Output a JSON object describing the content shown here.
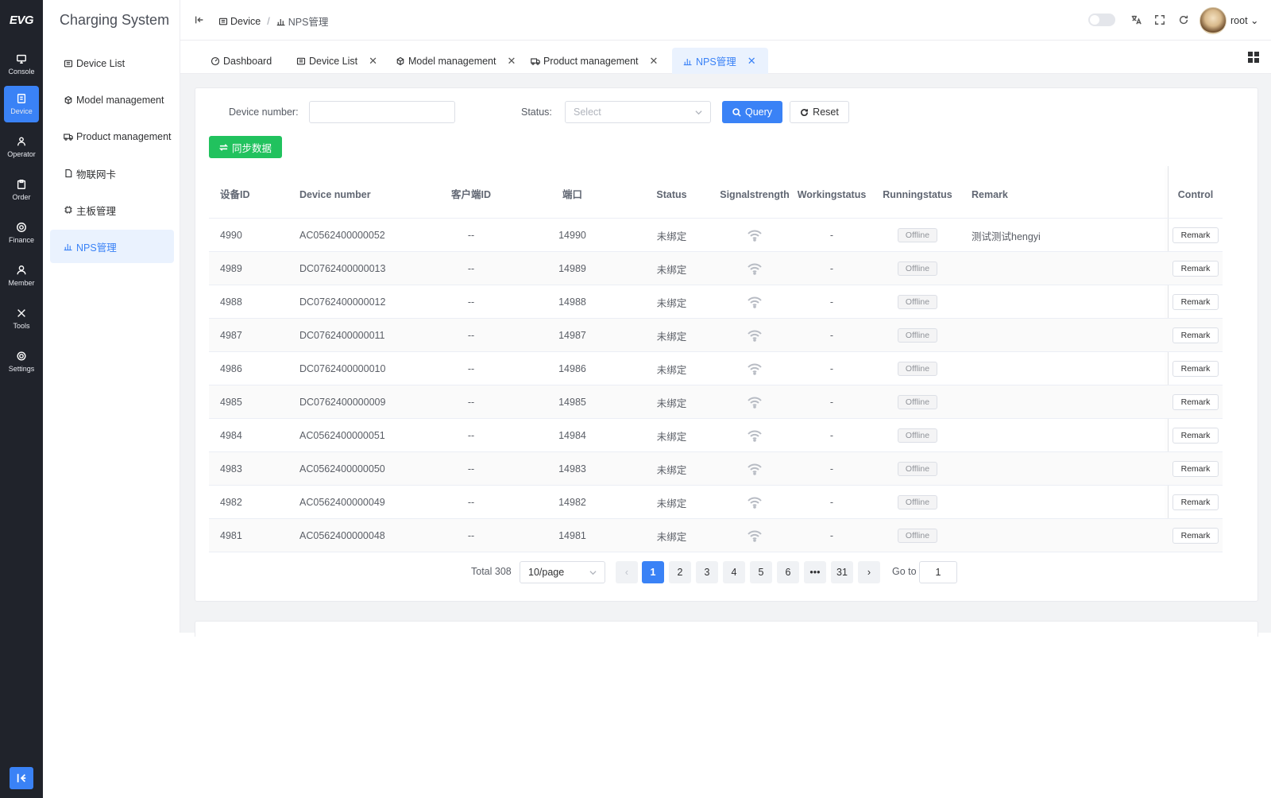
{
  "rail": {
    "logo": "EVG",
    "items": [
      {
        "label": "Console",
        "icon": "monitor-icon"
      },
      {
        "label": "Device",
        "icon": "device-icon"
      },
      {
        "label": "Operator",
        "icon": "operator-icon"
      },
      {
        "label": "Order",
        "icon": "clipboard-icon"
      },
      {
        "label": "Finance",
        "icon": "coin-icon"
      },
      {
        "label": "Member",
        "icon": "user-icon"
      },
      {
        "label": "Tools",
        "icon": "tools-icon"
      },
      {
        "label": "Settings",
        "icon": "gear-icon"
      }
    ]
  },
  "submenu": {
    "title": "Charging System",
    "items": [
      {
        "label": "Device List",
        "icon": "device-list-icon"
      },
      {
        "label": "Model management",
        "icon": "cube-icon"
      },
      {
        "label": "Product management",
        "icon": "truck-icon"
      },
      {
        "label": "物联网卡",
        "icon": "sim-card-icon"
      },
      {
        "label": "主板管理",
        "icon": "chip-icon"
      },
      {
        "label": "NPS管理",
        "icon": "bar-chart-icon"
      }
    ]
  },
  "header": {
    "breadcrumb": [
      "Device",
      "NPS管理"
    ],
    "user": "root"
  },
  "tabs": [
    {
      "label": "Dashboard",
      "closable": false
    },
    {
      "label": "Device List",
      "closable": true
    },
    {
      "label": "Model management",
      "closable": true
    },
    {
      "label": "Product management",
      "closable": true
    },
    {
      "label": "NPS管理",
      "closable": true
    }
  ],
  "filters": {
    "device_number_label": "Device number:",
    "device_number_value": "",
    "status_label": "Status:",
    "status_placeholder": "Select",
    "query_label": "Query",
    "reset_label": "Reset",
    "sync_label": "同步数据"
  },
  "table": {
    "headers": {
      "id": "设备ID",
      "device_number": "Device number",
      "client_id": "客户端ID",
      "port": "端口",
      "status": "Status",
      "signal1": "Signal",
      "signal2": "strength",
      "working1": "Working",
      "working2": "status",
      "running1": "Running",
      "running2": "status",
      "remark": "Remark",
      "control": "Control"
    },
    "rows": [
      {
        "id": "4990",
        "device_number": "AC0562400000052",
        "client_id": "--",
        "port": "14990",
        "status": "未绑定",
        "working": "-",
        "running": "Offline",
        "remark": "测试测试hengyi",
        "control": "Remark"
      },
      {
        "id": "4989",
        "device_number": "DC0762400000013",
        "client_id": "--",
        "port": "14989",
        "status": "未绑定",
        "working": "-",
        "running": "Offline",
        "remark": "",
        "control": "Remark"
      },
      {
        "id": "4988",
        "device_number": "DC0762400000012",
        "client_id": "--",
        "port": "14988",
        "status": "未绑定",
        "working": "-",
        "running": "Offline",
        "remark": "",
        "control": "Remark"
      },
      {
        "id": "4987",
        "device_number": "DC0762400000011",
        "client_id": "--",
        "port": "14987",
        "status": "未绑定",
        "working": "-",
        "running": "Offline",
        "remark": "",
        "control": "Remark"
      },
      {
        "id": "4986",
        "device_number": "DC0762400000010",
        "client_id": "--",
        "port": "14986",
        "status": "未绑定",
        "working": "-",
        "running": "Offline",
        "remark": "",
        "control": "Remark"
      },
      {
        "id": "4985",
        "device_number": "DC0762400000009",
        "client_id": "--",
        "port": "14985",
        "status": "未绑定",
        "working": "-",
        "running": "Offline",
        "remark": "",
        "control": "Remark"
      },
      {
        "id": "4984",
        "device_number": "AC0562400000051",
        "client_id": "--",
        "port": "14984",
        "status": "未绑定",
        "working": "-",
        "running": "Offline",
        "remark": "",
        "control": "Remark"
      },
      {
        "id": "4983",
        "device_number": "AC0562400000050",
        "client_id": "--",
        "port": "14983",
        "status": "未绑定",
        "working": "-",
        "running": "Offline",
        "remark": "",
        "control": "Remark"
      },
      {
        "id": "4982",
        "device_number": "AC0562400000049",
        "client_id": "--",
        "port": "14982",
        "status": "未绑定",
        "working": "-",
        "running": "Offline",
        "remark": "",
        "control": "Remark"
      },
      {
        "id": "4981",
        "device_number": "AC0562400000048",
        "client_id": "--",
        "port": "14981",
        "status": "未绑定",
        "working": "-",
        "running": "Offline",
        "remark": "",
        "control": "Remark"
      }
    ]
  },
  "pagination": {
    "total": "Total 308",
    "page_size": "10/page",
    "pages": [
      "1",
      "2",
      "3",
      "4",
      "5",
      "6",
      "•••",
      "31"
    ],
    "current": "1",
    "goto_label": "Go to",
    "goto_value": "1"
  },
  "colors": {
    "primary": "#3a82f6",
    "success": "#21c25e",
    "rail_bg": "#20232b"
  }
}
